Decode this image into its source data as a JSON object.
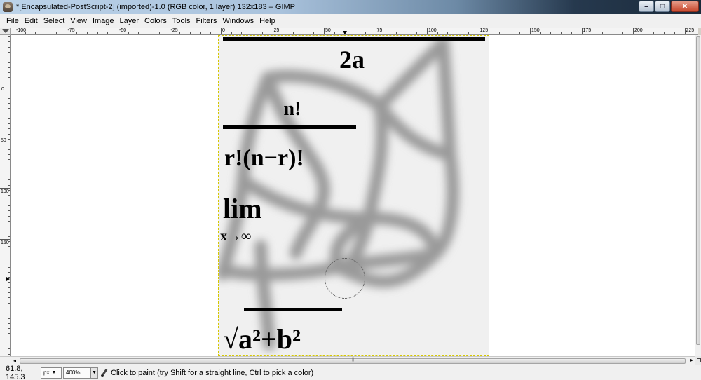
{
  "window": {
    "title": "*[Encapsulated-PostScript-2] (imported)-1.0 (RGB color, 1 layer) 132x183 – GIMP",
    "minimize_glyph": "–",
    "maximize_glyph": "□",
    "close_glyph": "✕"
  },
  "menu": [
    {
      "label": "File"
    },
    {
      "label": "Edit"
    },
    {
      "label": "Select"
    },
    {
      "label": "View"
    },
    {
      "label": "Image"
    },
    {
      "label": "Layer"
    },
    {
      "label": "Colors"
    },
    {
      "label": "Tools"
    },
    {
      "label": "Filters"
    },
    {
      "label": "Windows"
    },
    {
      "label": "Help"
    }
  ],
  "rulers": {
    "horizontal_labels": [
      "-100",
      "-75",
      "-50",
      "-25",
      "0",
      "25",
      "50",
      "75",
      "100",
      "125",
      "150",
      "175",
      "200",
      "225"
    ],
    "vertical_labels": [
      "0",
      "50",
      "100",
      "150"
    ]
  },
  "canvas": {
    "formula_top": "2a",
    "formula_numerator": "n!",
    "formula_denominator": "r!(n−r)!",
    "formula_lim": "lim",
    "formula_lim_sub": "x→∞",
    "formula_sqrt": "√a²+b²"
  },
  "statusbar": {
    "coordinates": "61.8, 145.3",
    "unit": "px",
    "unit_arrow": "▼",
    "zoom": "400%",
    "zoom_arrow": "▼",
    "message": "Click to paint (try Shift for a straight line, Ctrl to pick a color)"
  },
  "scrollbar": {
    "left_arrow": "◂",
    "right_arrow": "▸",
    "grip": "||||"
  }
}
